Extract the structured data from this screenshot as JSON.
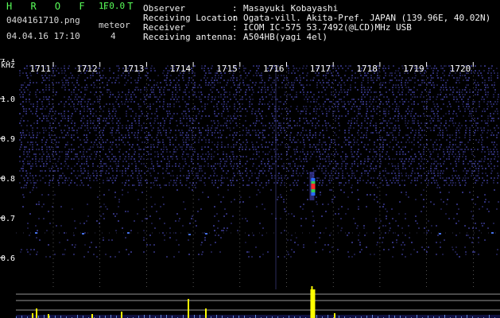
{
  "app": {
    "title": "H R O F F T",
    "version": "1.0.0"
  },
  "file": {
    "name": "0404161710.png",
    "datetime": "04.04.16 17:10"
  },
  "meteor": {
    "label": "meteor",
    "count": "4"
  },
  "info": [
    {
      "key": "Observer",
      "sep": ":",
      "value": "Masayuki Kobayashi"
    },
    {
      "key": "Receiving Location",
      "sep": ":",
      "value": "Ogata-vill. Akita-Pref. JAPAN (139.96E, 40.02N)"
    },
    {
      "key": "Receiver",
      "sep": ":",
      "value": "ICOM IC-575 53.7492(@LCD)MHz USB"
    },
    {
      "key": "Receiving antenna",
      "sep": ":",
      "value": "A504HB(yagi 4el)"
    }
  ],
  "chart_data": {
    "type": "heatmap",
    "ylabel": "kHz",
    "yticks": [
      "1.1",
      "1.0",
      "0.9",
      "0.8",
      "0.7",
      "0.6"
    ],
    "yticks_values": [
      1.1,
      1.0,
      0.9,
      0.8,
      0.7,
      0.6
    ],
    "xticks": [
      "1711",
      "1712",
      "1713",
      "1714",
      "1715",
      "1716",
      "1717",
      "1718",
      "1719",
      "1720"
    ],
    "events": [
      {
        "time": "1716.8",
        "freq_khz": 0.78,
        "intensity": "strong"
      }
    ],
    "colors": {
      "background": "#0a0a2e",
      "noise": "#3a3a90",
      "signal": "#ffff00",
      "grid": "#ffffff"
    }
  }
}
